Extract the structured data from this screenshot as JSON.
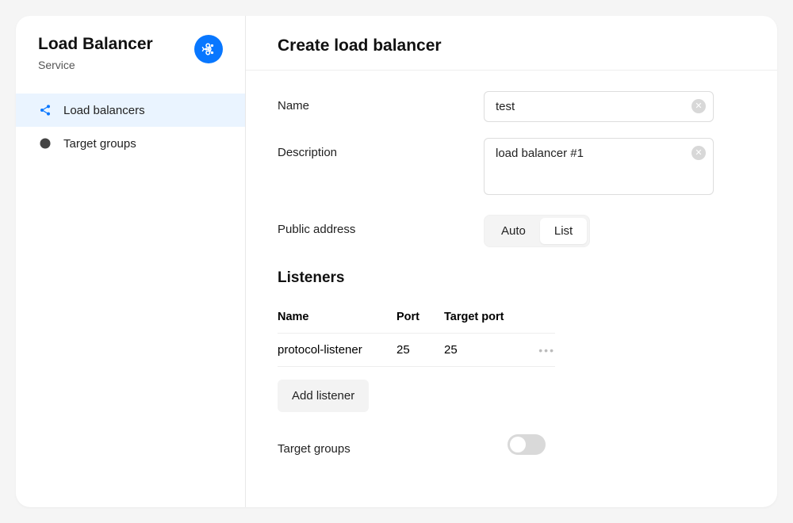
{
  "sidebar": {
    "title": "Load Balancer",
    "subtitle": "Service",
    "items": [
      {
        "label": "Load balancers",
        "active": true,
        "icon": "share"
      },
      {
        "label": "Target groups",
        "active": false,
        "icon": "target"
      }
    ]
  },
  "page": {
    "title": "Create load balancer"
  },
  "form": {
    "name_label": "Name",
    "name_value": "test",
    "desc_label": "Description",
    "desc_value": "load balancer #1",
    "addr_label": "Public address",
    "addr_options": {
      "auto": "Auto",
      "list": "List"
    },
    "addr_selected": "list"
  },
  "listeners": {
    "title": "Listeners",
    "columns": {
      "name": "Name",
      "port": "Port",
      "target_port": "Target port"
    },
    "rows": [
      {
        "name": "protocol-listener",
        "port": "25",
        "target_port": "25"
      }
    ],
    "add_label": "Add listener"
  },
  "target_groups": {
    "label": "Target groups",
    "enabled": false
  }
}
